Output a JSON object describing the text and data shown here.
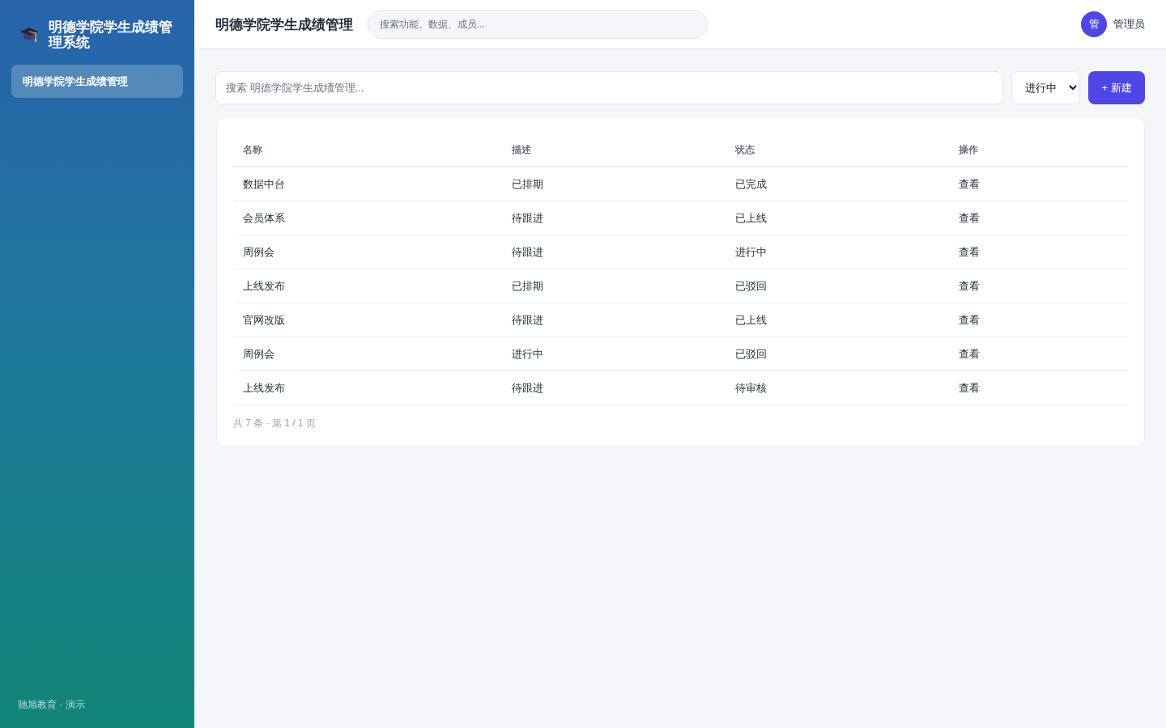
{
  "sidebar": {
    "brand": "明德学院学生成绩管理系统",
    "items": [
      {
        "label": "明德学院学生成绩管理",
        "selected": true
      }
    ],
    "footer": "驰旭教育 · 演示"
  },
  "topbar": {
    "title": "明德学院学生成绩管理",
    "search": {
      "placeholder": "搜索功能、数据、成员..."
    },
    "user": {
      "avatar": "管",
      "name": "管理员"
    }
  },
  "toolbar": {
    "search": {
      "placeholder": "搜索 明德学院学生成绩管理..."
    },
    "filter": {
      "value": "进行中"
    },
    "new_button": "+ 新建"
  },
  "table": {
    "columns": [
      "名称",
      "描述",
      "状态",
      "操作"
    ],
    "rows": [
      {
        "name": "数据中台",
        "description": "已排期",
        "status": "已完成",
        "action": "查看"
      },
      {
        "name": "会员体系",
        "description": "待跟进",
        "status": "已上线",
        "action": "查看"
      },
      {
        "name": "周例会",
        "description": "待跟进",
        "status": "进行中",
        "action": "查看"
      },
      {
        "name": "上线发布",
        "description": "已排期",
        "status": "已驳回",
        "action": "查看"
      },
      {
        "name": "官网改版",
        "description": "待跟进",
        "status": "已上线",
        "action": "查看"
      },
      {
        "name": "周例会",
        "description": "进行中",
        "status": "已驳回",
        "action": "查看"
      },
      {
        "name": "上线发布",
        "description": "待跟进",
        "status": "待审核",
        "action": "查看"
      }
    ],
    "pagination": "共 7 条 · 第 1 / 1 页"
  }
}
